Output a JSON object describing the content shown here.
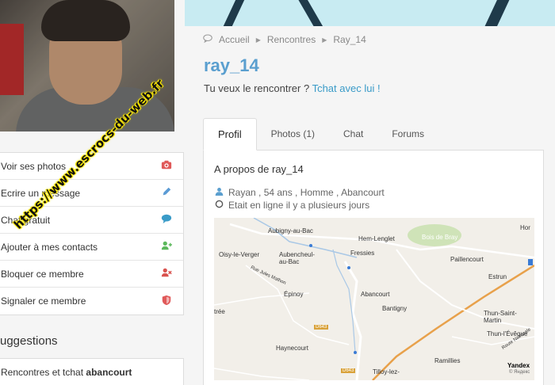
{
  "watermark": "https://www.escrocs-du-web.fr",
  "sidebar": {
    "items": [
      {
        "label": "Voir ses photos",
        "icon": "camera-icon",
        "color": "#e05a5a"
      },
      {
        "label": "Ecrire un message",
        "icon": "pencil-icon",
        "color": "#5b9bd5"
      },
      {
        "label": "Chat gratuit",
        "icon": "chat-bubble-icon",
        "color": "#3a9bc8"
      },
      {
        "label": "Ajouter à mes contacts",
        "icon": "add-user-icon",
        "color": "#5cb85c"
      },
      {
        "label": "Bloquer ce membre",
        "icon": "block-user-icon",
        "color": "#d9534f"
      },
      {
        "label": "Signaler ce membre",
        "icon": "shield-icon",
        "color": "#e05a5a"
      }
    ]
  },
  "suggestions": {
    "title": "uggestions",
    "text": "Rencontres et tchat ",
    "bold": "abancourt"
  },
  "breadcrumb": {
    "home": "Accueil",
    "section": "Rencontres",
    "current": "Ray_14"
  },
  "profile": {
    "username": "ray_14",
    "tagline_prefix": "Tu veux le rencontrer ? ",
    "tagline_link": "Tchat avec lui !"
  },
  "tabs": [
    {
      "label": "Profil",
      "active": true
    },
    {
      "label": "Photos (1)",
      "active": false
    },
    {
      "label": "Chat",
      "active": false
    },
    {
      "label": "Forums",
      "active": false
    }
  ],
  "about": {
    "title": "A propos de ray_14",
    "details": "Rayan , 54 ans , Homme , Abancourt",
    "status": "Etait en ligne il y a plusieurs jours"
  },
  "map": {
    "places": [
      "Aubigny-au-Bac",
      "Hem-Lenglet",
      "Bois de Bray",
      "Hor",
      "Oisy-le-Verger",
      "Aubencheul-au-Bac",
      "Fressies",
      "Paillencourt",
      "Estrun",
      "Rue Jules Mathon",
      "Épinoy",
      "Abancourt",
      "Bantigny",
      "trée",
      "Thun-Saint-Martin",
      "Thun-l'Évêque",
      "Haynecourt",
      "Ramillies",
      "Tilloy-lez-",
      "Route Nationale",
      "Yandex"
    ],
    "roads": [
      "D643",
      "D643"
    ],
    "copyright": "© Яндекс"
  },
  "colors": {
    "accent": "#5a9fcf",
    "link": "#3a9bc8"
  }
}
